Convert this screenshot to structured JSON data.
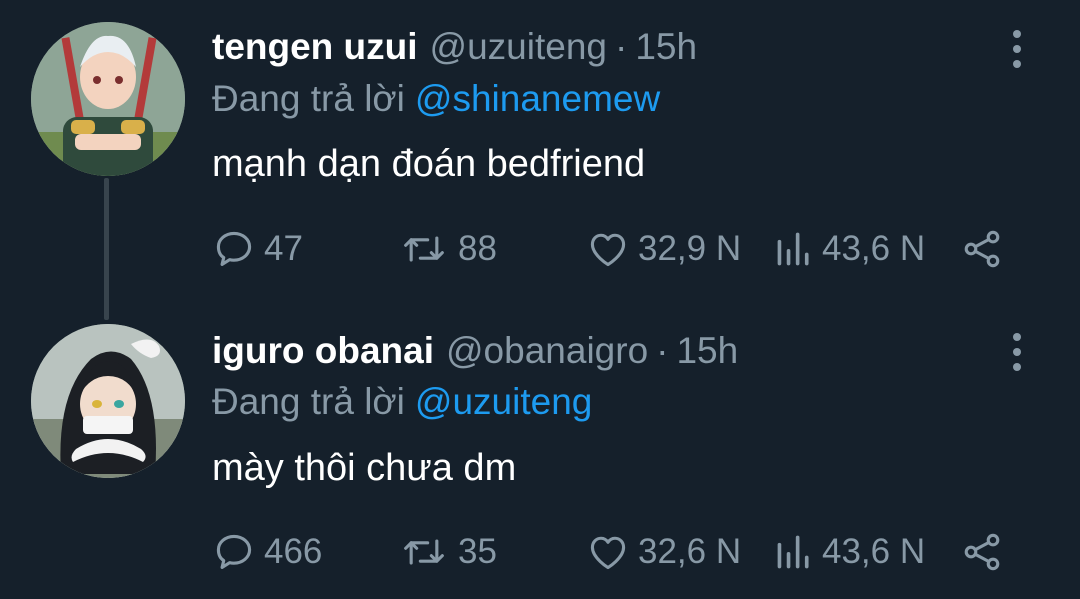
{
  "tweets": [
    {
      "display_name": "tengen uzui",
      "handle": "@uzuiteng",
      "separator": "·",
      "time": "15h",
      "reply_prefix": "Đang trả lời",
      "reply_to": "@shinanemew",
      "text": "mạnh dạn đoán bedfriend",
      "stats": {
        "replies": "47",
        "retweets": "88",
        "likes": "32,9 N",
        "views": "43,6 N"
      },
      "icons": {
        "reply": "reply-icon",
        "retweet": "retweet-icon",
        "like": "heart-icon",
        "views": "analytics-icon",
        "share": "share-icon",
        "more": "more-icon"
      }
    },
    {
      "display_name": "iguro obanai",
      "handle": "@obanaigro",
      "separator": "·",
      "time": "15h",
      "reply_prefix": "Đang trả lời",
      "reply_to": "@uzuiteng",
      "text": "mày thôi chưa dm",
      "stats": {
        "replies": "466",
        "retweets": "35",
        "likes": "32,6 N",
        "views": "43,6 N"
      },
      "icons": {
        "reply": "reply-icon",
        "retweet": "retweet-icon",
        "like": "heart-icon",
        "views": "analytics-icon",
        "share": "share-icon",
        "more": "more-icon"
      }
    }
  ],
  "colors": {
    "background": "#15202b",
    "primary_text": "#ffffff",
    "secondary_text": "#8899a6",
    "mention": "#1d9bf0",
    "thread_line": "#38444d"
  }
}
